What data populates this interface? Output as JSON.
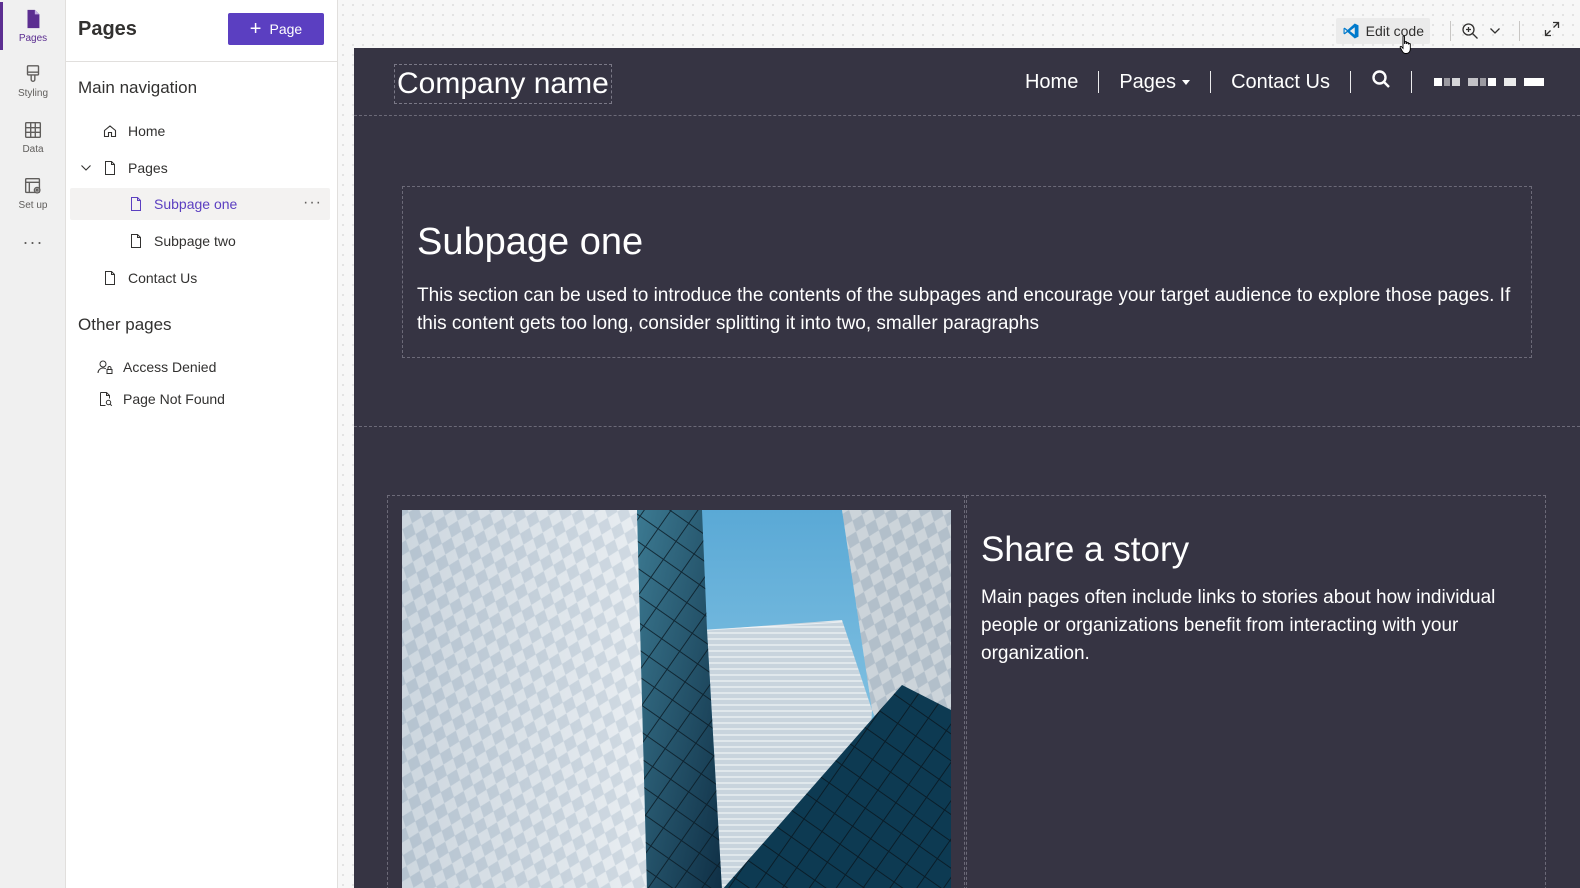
{
  "rail": {
    "items": [
      {
        "label": "Pages",
        "icon": "page-icon"
      },
      {
        "label": "Styling",
        "icon": "brush-icon"
      },
      {
        "label": "Data",
        "icon": "table-icon"
      },
      {
        "label": "Set up",
        "icon": "setup-icon"
      }
    ],
    "more": "···"
  },
  "panel": {
    "title": "Pages",
    "add_button": "Page",
    "main_nav_title": "Main navigation",
    "main_nav": {
      "home": "Home",
      "pages": "Pages",
      "subpage_one": "Subpage one",
      "subpage_two": "Subpage two",
      "contact": "Contact Us"
    },
    "more_dots": "···",
    "other_title": "Other pages",
    "other": {
      "access_denied": "Access Denied",
      "not_found": "Page Not Found"
    }
  },
  "toolbar": {
    "edit_code": "Edit code"
  },
  "site": {
    "company": "Company name",
    "nav": {
      "home": "Home",
      "pages": "Pages",
      "contact": "Contact Us"
    },
    "section1": {
      "title": "Subpage one",
      "body": "This section can be used to introduce the contents of the subpages and encourage your target audience to explore those pages. If this content gets too long, consider splitting it into two, smaller paragraphs"
    },
    "section2": {
      "title": "Share a story",
      "body": "Main pages often include links to stories about how individual people or organizations benefit from interacting with your organization."
    }
  },
  "colors": {
    "accent": "#5b3fc1",
    "site_background": "#363443",
    "vscode_blue": "#007acc"
  }
}
